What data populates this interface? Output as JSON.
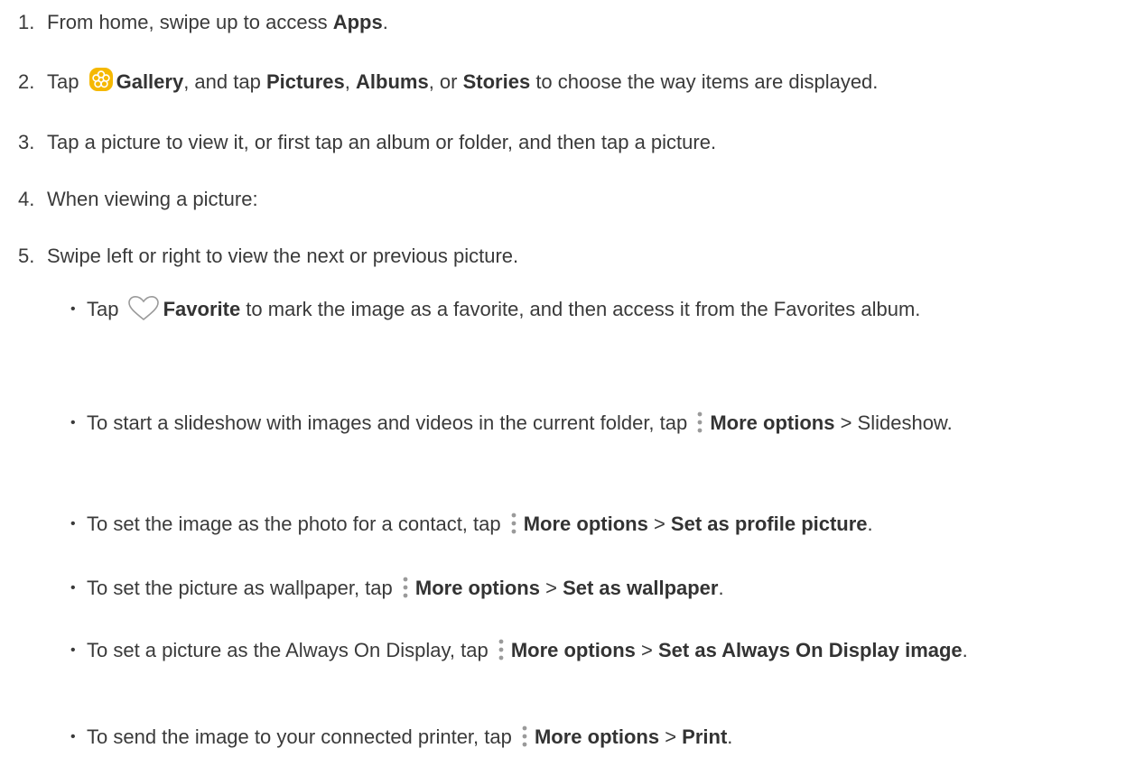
{
  "steps": [
    {
      "num": "1.",
      "t1": "From home, swipe up to access ",
      "b1": "Apps",
      "t2": "."
    },
    {
      "num": "2.",
      "t1": "Tap",
      "b1": "Gallery",
      "t2": ", and tap ",
      "b2": "Pictures",
      "t3": ", ",
      "b3": "Albums",
      "t4": ", or ",
      "b4": "Stories",
      "t5": " to choose the way items are displayed."
    },
    {
      "num": "3.",
      "text": "Tap a picture to view it, or first tap an album or folder, and then tap a picture."
    },
    {
      "num": "4.",
      "text": "When viewing a picture:"
    },
    {
      "num": "5.",
      "text": "Swipe left or right to view the next or previous picture."
    }
  ],
  "bullets": [
    {
      "t1": "Tap",
      "b1": "Favorite",
      "t2": " to mark the image as a favorite, and then access it from the Favorites album."
    },
    {
      "t1": "To start a slideshow with images and videos in the current folder, tap",
      "b1": "More options",
      "t2": " > Slideshow."
    },
    {
      "t1": "To set the image as the photo for a contact, tap",
      "b1": "More options",
      "t2": " > ",
      "b2": "Set as profile picture",
      "t3": "."
    },
    {
      "t1": "To set the picture as wallpaper, tap",
      "b1": "More options",
      "t2": " > ",
      "b2": "Set as wallpaper",
      "t3": "."
    },
    {
      "t1": "To set a picture as the Always On Display, tap",
      "b1": "More options",
      "t2": " > ",
      "b2": "Set as Always On Display image",
      "t3": "."
    },
    {
      "t1": "To send the image to your connected printer, tap",
      "b1": "More options",
      "t2": " > ",
      "b2": "Print",
      "t3": "."
    }
  ],
  "bullet_glyph": "•",
  "icons": {
    "gallery": "gallery-icon",
    "favorite": "heart-icon",
    "more": "more-options-icon"
  },
  "colors": {
    "text": "#3a3a3a",
    "gallery_icon": "#f5b800"
  }
}
